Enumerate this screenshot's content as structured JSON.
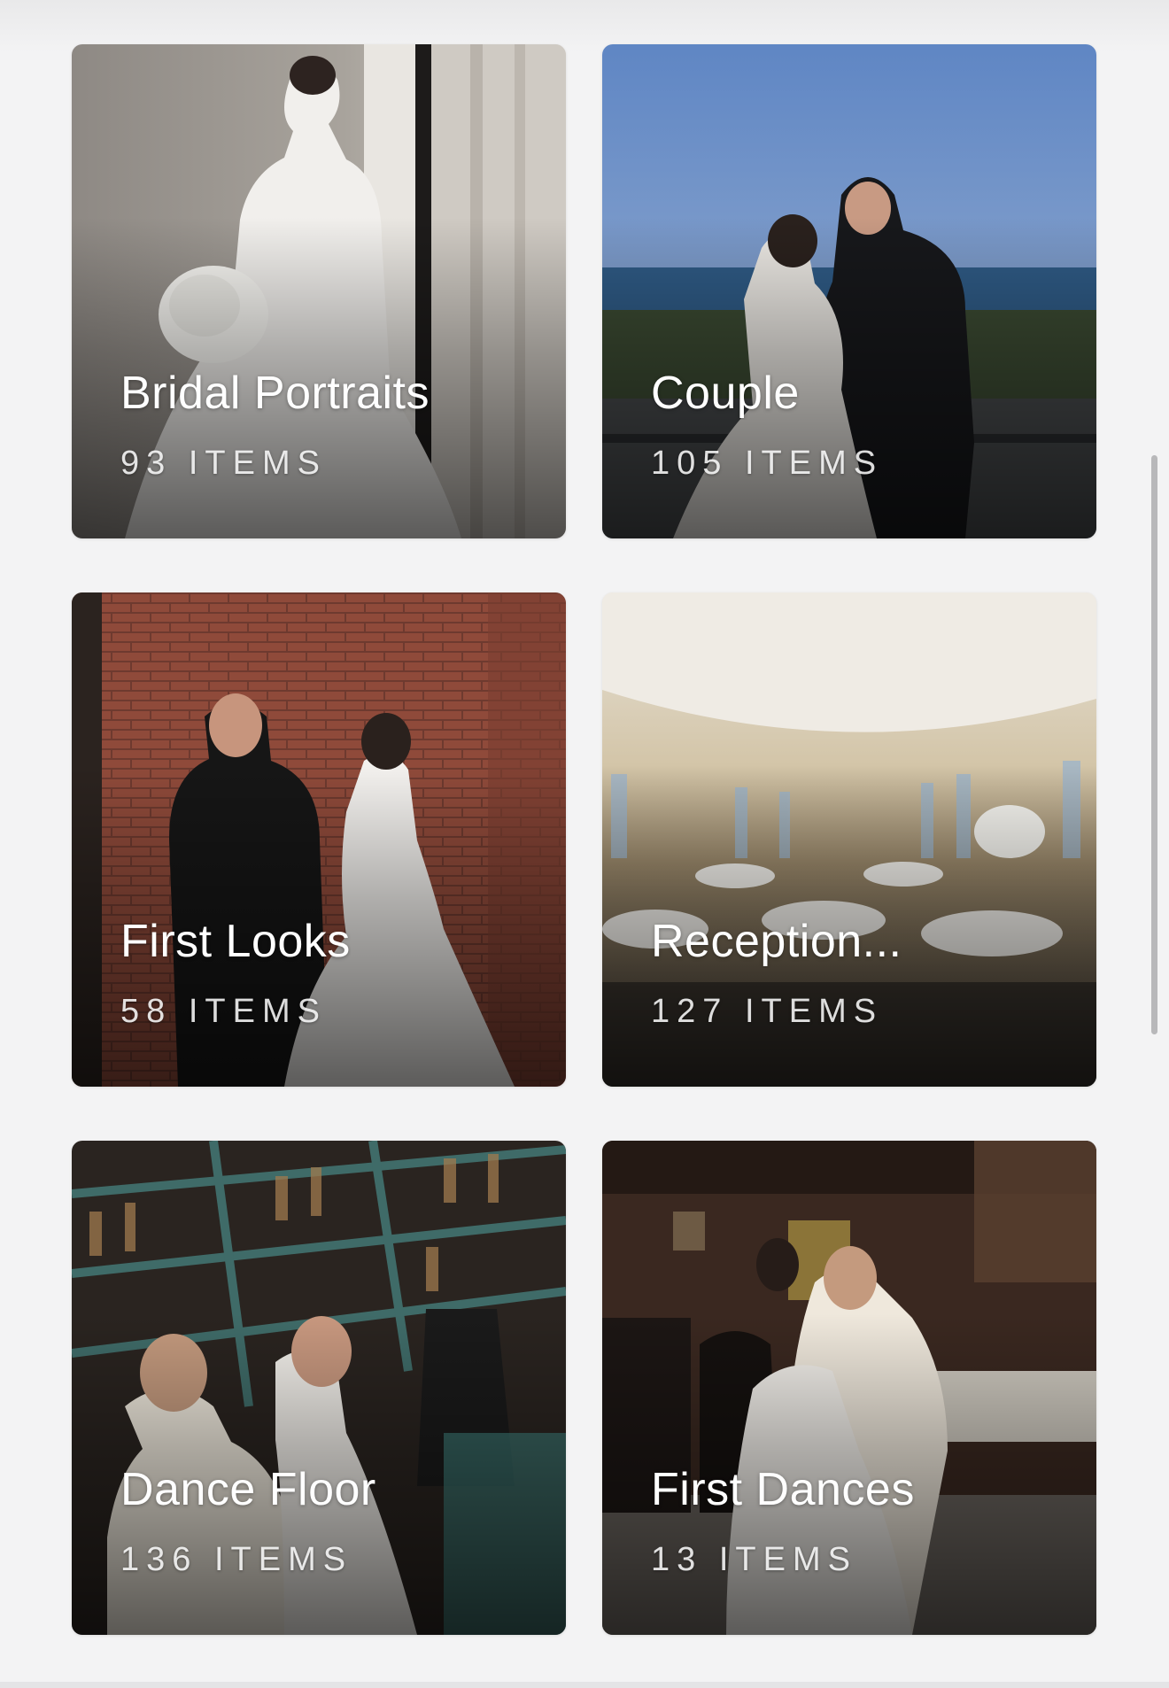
{
  "galleries": [
    {
      "title": "Bridal Portraits",
      "count": "93 ITEMS"
    },
    {
      "title": "Couple",
      "count": "105 ITEMS"
    },
    {
      "title": "First Looks",
      "count": "58 ITEMS"
    },
    {
      "title": "Reception...",
      "count": "127 ITEMS"
    },
    {
      "title": "Dance Floor",
      "count": "136 ITEMS"
    },
    {
      "title": "First Dances",
      "count": "13 ITEMS"
    }
  ],
  "colors": {
    "background": "#f3f3f4",
    "text_on_photo": "#ffffff",
    "scrollbar": "#b8b8ba"
  }
}
